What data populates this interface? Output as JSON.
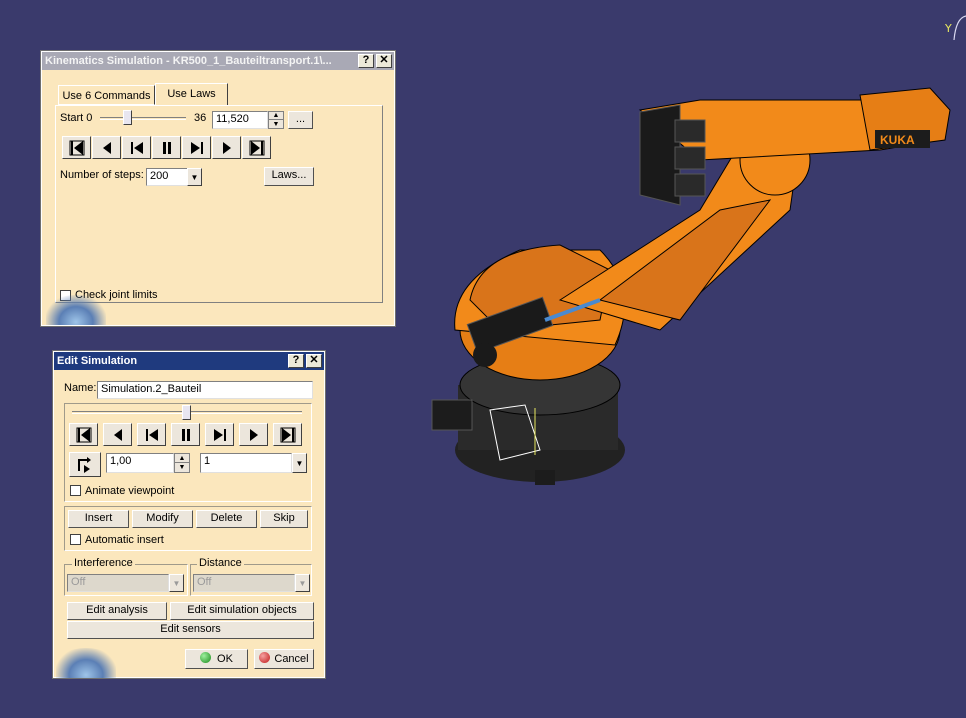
{
  "viewport": {
    "axis_label": "Y",
    "background": "#3a3a6c",
    "robot_color": "#f28a1a",
    "robot_brand": "KUKA"
  },
  "kin": {
    "title": "Kinematics Simulation - KR500_1_Bauteiltransport.1\\...",
    "help": "?",
    "close": "✕",
    "tabs": [
      "Use 6 Commands",
      "Use Laws"
    ],
    "active_tab": "Use Laws",
    "start_label": "Start 0",
    "end_label": "36",
    "slider_value_fraction": 0.32,
    "time_value": "11,520",
    "more_label": "...",
    "steps_label": "Number of steps:",
    "steps_value": "200",
    "laws_label": "Laws...",
    "joint_limits_label": "Check joint limits"
  },
  "edit": {
    "title": "Edit Simulation",
    "help": "?",
    "close": "✕",
    "name_label": "Name:",
    "name_value": "Simulation.2_Bauteil",
    "slider_value_fraction": 0.5,
    "step_value": "1,00",
    "interp_value": "1",
    "animate_label": "Animate viewpoint",
    "insert_label": "Insert",
    "modify_label": "Modify",
    "delete_label": "Delete",
    "skip_label": "Skip",
    "auto_insert_label": "Automatic insert",
    "interference_label": "Interference",
    "interference_value": "Off",
    "distance_label": "Distance",
    "distance_value": "Off",
    "edit_analysis_label": "Edit analysis",
    "edit_objects_label": "Edit simulation objects",
    "edit_sensors_label": "Edit sensors",
    "ok_label": "OK",
    "cancel_label": "Cancel"
  }
}
